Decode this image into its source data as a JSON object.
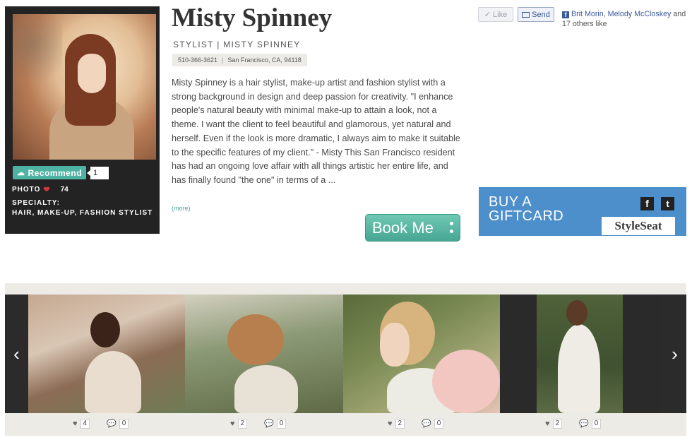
{
  "profile": {
    "name": "Misty Spinney",
    "role": "STYLIST | MISTY SPINNEY",
    "phone": "510-366-3621",
    "location": "San Francisco, CA, 94118",
    "bio": "Misty Spinney is a hair stylist, make-up artist and fashion stylist with a strong background in design and deep passion for creativity. \"I enhance people's natural beauty with minimal make-up to attain a look, not a theme. I want the client to feel beautiful and glamorous, yet natural and herself. Even if the look is more dramatic, I always aim to make it suitable to the specific features of my client.\" - Misty This San Francisco resident has had an ongoing love affair with all things artistic her entire life, and has finally found \"the one\" in terms of a ...",
    "more_label": "(more)",
    "book_label": "Book Me"
  },
  "card": {
    "recommend_label": "Recommend",
    "recommend_count": "1",
    "photo_label": "PHOTO",
    "photo_count": "74",
    "specialty_label": "SPECIALTY:",
    "specialty_value": "HAIR, MAKE-UP, FASHION STYLIST"
  },
  "facebook": {
    "like_label": "Like",
    "send_label": "Send",
    "friend_1": "Brit Morin",
    "friend_2": "Melody McCloskey",
    "others_text": "and 17 others like"
  },
  "giftcard": {
    "title": "BUY A GIFTCARD",
    "logo": "StyleSeat",
    "accent": "#4c8fcb"
  },
  "gallery": {
    "photos": [
      {
        "likes": "4",
        "comments": "0"
      },
      {
        "likes": "2",
        "comments": "0"
      },
      {
        "likes": "2",
        "comments": "0"
      },
      {
        "likes": "2",
        "comments": "0"
      }
    ]
  },
  "colors": {
    "teal": "#4fb3a3",
    "facebook": "#3b5998",
    "heart": "#d9393e"
  }
}
